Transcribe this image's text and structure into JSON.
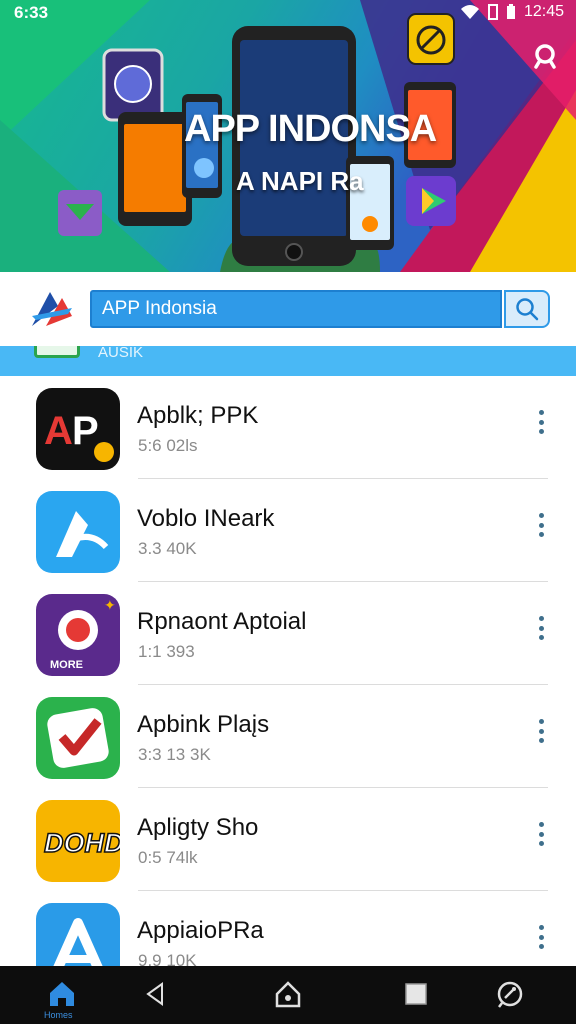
{
  "status_bar": {
    "time_left": "6:33",
    "time_right": "12:45"
  },
  "banner": {
    "title": "APP INDONSA",
    "subtitle": "A NAPI Ra",
    "search_icon": "search-icon"
  },
  "search": {
    "value": "APP Indonsia",
    "button_icon": "search-icon"
  },
  "category": {
    "label": "AUSIK"
  },
  "apps": [
    {
      "name": "Apblk; PPK",
      "size": "5:6 02ls",
      "icon_text": "AP",
      "icon_color": "#111111"
    },
    {
      "name": "Voblo INeark",
      "size": "3.3 40K",
      "icon_text": "",
      "icon_color": "#2aa6f0"
    },
    {
      "name": "Rpnaont Aptoial",
      "size": "1:1 393",
      "icon_text": "MORE",
      "icon_color": "#5a2a8c"
    },
    {
      "name": "Apbink Plaįs",
      "size": "3:3 13 3K",
      "icon_text": "",
      "icon_color": "#2bb24c"
    },
    {
      "name": "Apligty Sho",
      "size": "0:5 74lk",
      "icon_text": "DOHD",
      "icon_color": "#f7b500"
    },
    {
      "name": "AppiaioPRa",
      "size": "9.9 10K",
      "icon_text": "",
      "icon_color": "#2a9be8"
    }
  ],
  "bottom_nav": {
    "home_label": "Homes"
  }
}
